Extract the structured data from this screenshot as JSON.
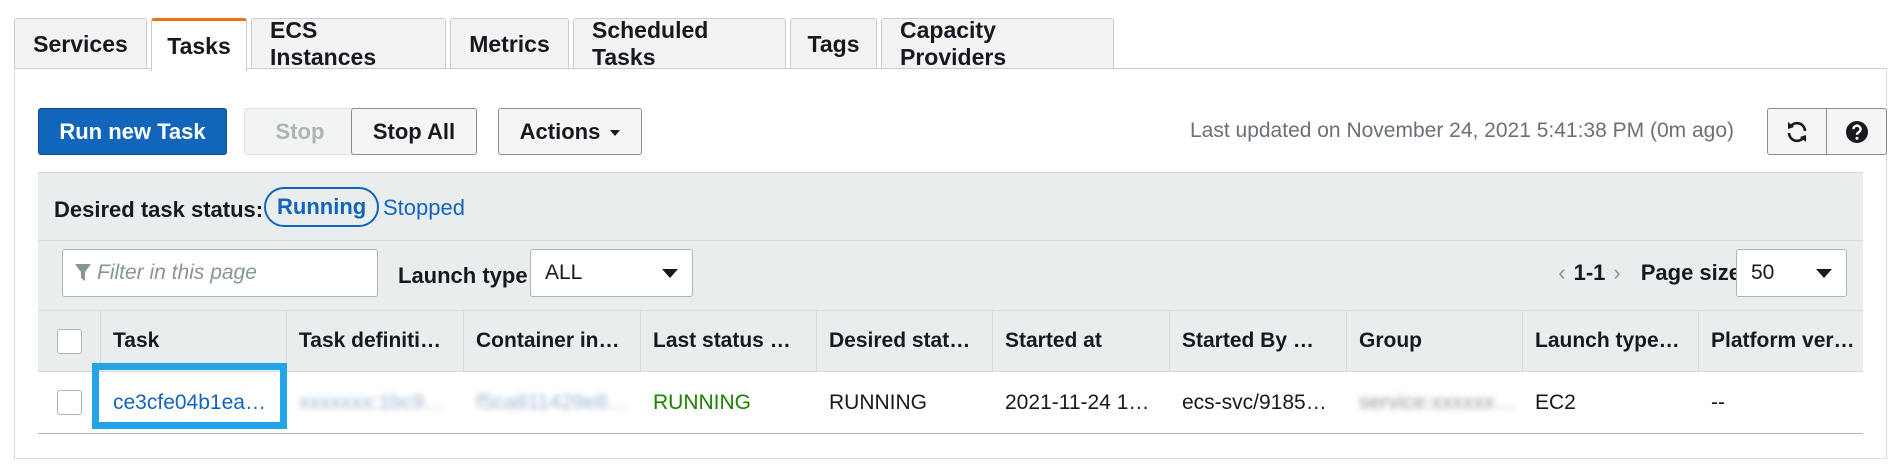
{
  "tabs": [
    {
      "label": "Services",
      "active": false
    },
    {
      "label": "Tasks",
      "active": true
    },
    {
      "label": "ECS Instances",
      "active": false
    },
    {
      "label": "Metrics",
      "active": false
    },
    {
      "label": "Scheduled Tasks",
      "active": false
    },
    {
      "label": "Tags",
      "active": false
    },
    {
      "label": "Capacity Providers",
      "active": false
    }
  ],
  "toolbar": {
    "run_new_task": "Run new Task",
    "stop": "Stop",
    "stop_all": "Stop All",
    "actions": "Actions",
    "last_updated": "Last updated on November 24, 2021 5:41:38 PM (0m ago)"
  },
  "status_filter": {
    "label": "Desired task status:",
    "running": "Running",
    "stopped": "Stopped"
  },
  "filter": {
    "placeholder": "Filter in this page",
    "launch_type_label": "Launch type",
    "launch_type_value": "ALL",
    "range": "1-1",
    "page_size_label": "Page size",
    "page_size_value": "50"
  },
  "table": {
    "headers": [
      "Task",
      "Task definiti…",
      "Container in…",
      "Last status …",
      "Desired stat…",
      "Started at",
      "Started By …",
      "Group",
      "Launch type…",
      "Platform ver…"
    ],
    "rows": [
      {
        "task": "ce3cfe04b1ea…",
        "task_definition": "xxxxxxx:1bc9…",
        "container_instance": "f5ca811429e8…",
        "last_status": "RUNNING",
        "desired_status": "RUNNING",
        "started_at": "2021-11-24 1…",
        "started_by": "ecs-svc/9185…",
        "group": "service:xxxxxx…",
        "launch_type": "EC2",
        "platform_version": "--"
      }
    ]
  },
  "colors": {
    "primary": "#1166bb",
    "accent_tab": "#ec7211",
    "running_green": "#1d8102",
    "highlight": "#24a3e8"
  }
}
